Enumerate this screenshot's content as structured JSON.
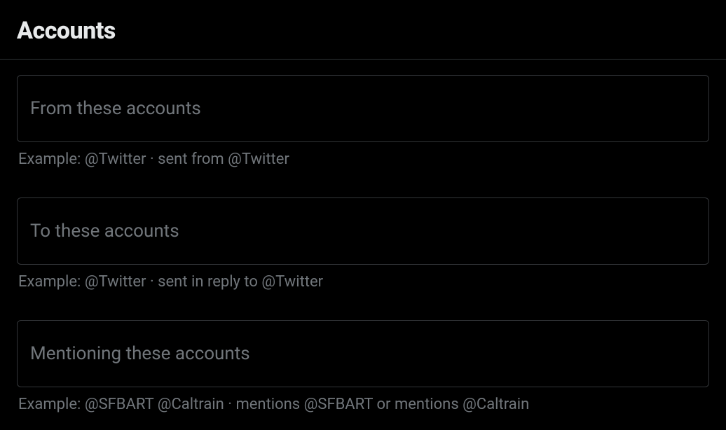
{
  "section": {
    "title": "Accounts"
  },
  "fields": {
    "from": {
      "placeholder": "From these accounts",
      "helper": "Example: @Twitter · sent from @Twitter",
      "value": ""
    },
    "to": {
      "placeholder": "To these accounts",
      "helper": "Example: @Twitter · sent in reply to @Twitter",
      "value": ""
    },
    "mentioning": {
      "placeholder": "Mentioning these accounts",
      "helper": "Example: @SFBART @Caltrain · mentions @SFBART or mentions @Caltrain",
      "value": ""
    }
  }
}
